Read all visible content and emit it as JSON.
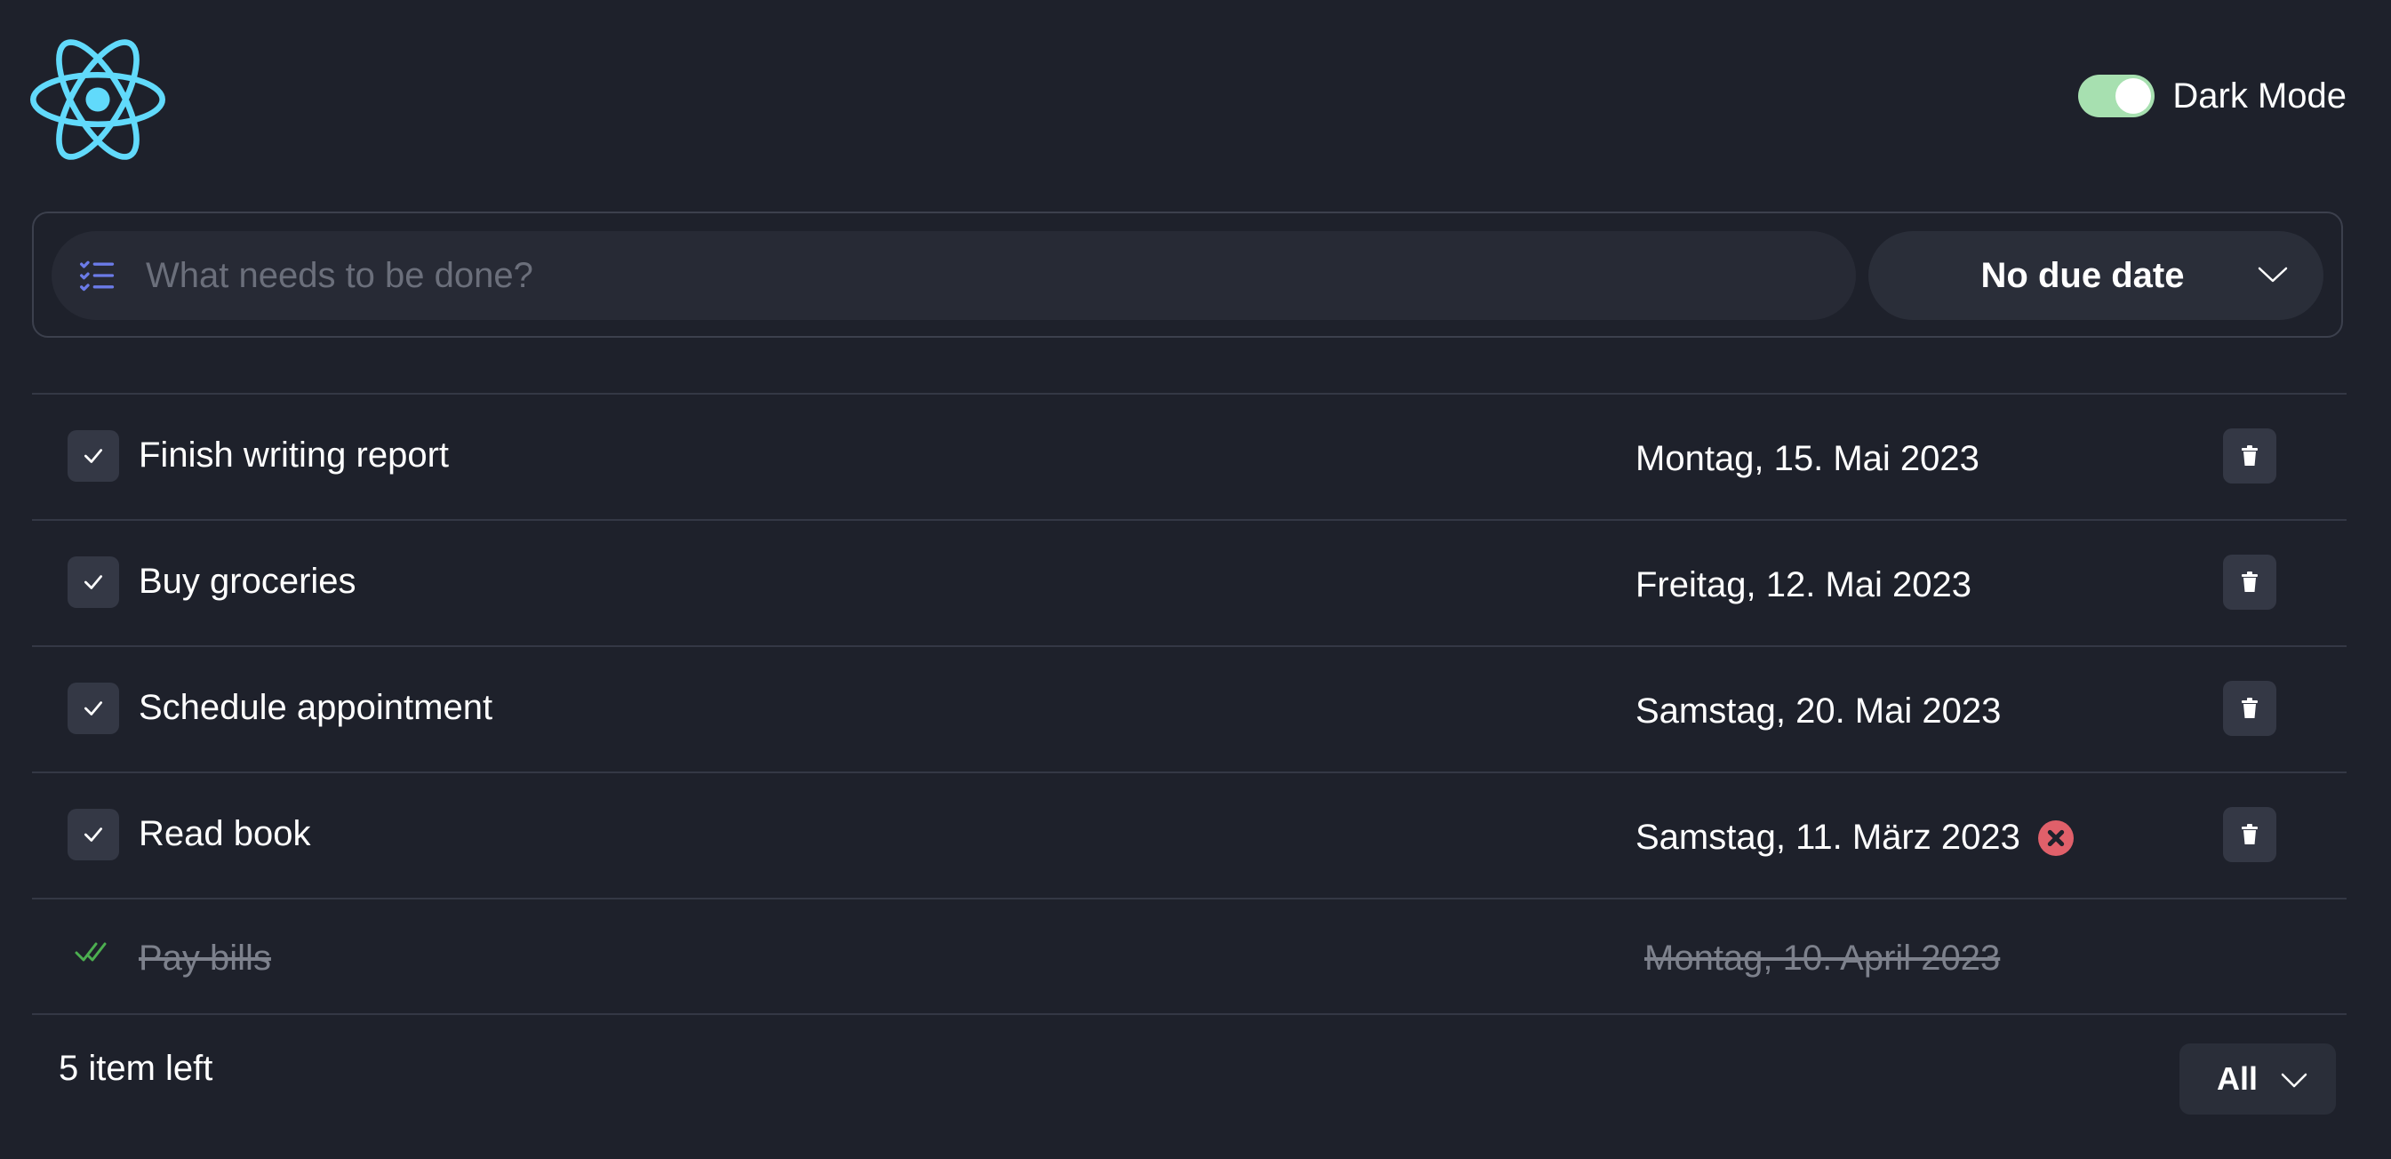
{
  "header": {
    "logo_icon": "react-atom-icon",
    "logo_color": "#61dafb",
    "dark_mode_label": "Dark Mode",
    "dark_mode_on": true,
    "toggle_color": "#a7e0b0"
  },
  "new_todo": {
    "icon": "checklist-icon",
    "placeholder": "What needs to be done?",
    "value": "",
    "due_date_selected": "No due date"
  },
  "todos": [
    {
      "title": "Finish writing report",
      "date": "Montag, 15. Mai 2023",
      "completed": false,
      "overdue": false
    },
    {
      "title": "Buy groceries",
      "date": "Freitag, 12. Mai 2023",
      "completed": false,
      "overdue": false
    },
    {
      "title": "Schedule appointment",
      "date": "Samstag, 20. Mai 2023",
      "completed": false,
      "overdue": false
    },
    {
      "title": "Read book",
      "date": "Samstag, 11. März 2023",
      "completed": false,
      "overdue": true
    },
    {
      "title": "Pay bills",
      "date": "Montag, 10. April 2023",
      "completed": true,
      "overdue": false
    }
  ],
  "footer": {
    "items_left": "5 item left",
    "filter_selected": "All"
  },
  "colors": {
    "background": "#1e212b",
    "overdue": "#e0606a",
    "done_check": "#4caf50"
  }
}
